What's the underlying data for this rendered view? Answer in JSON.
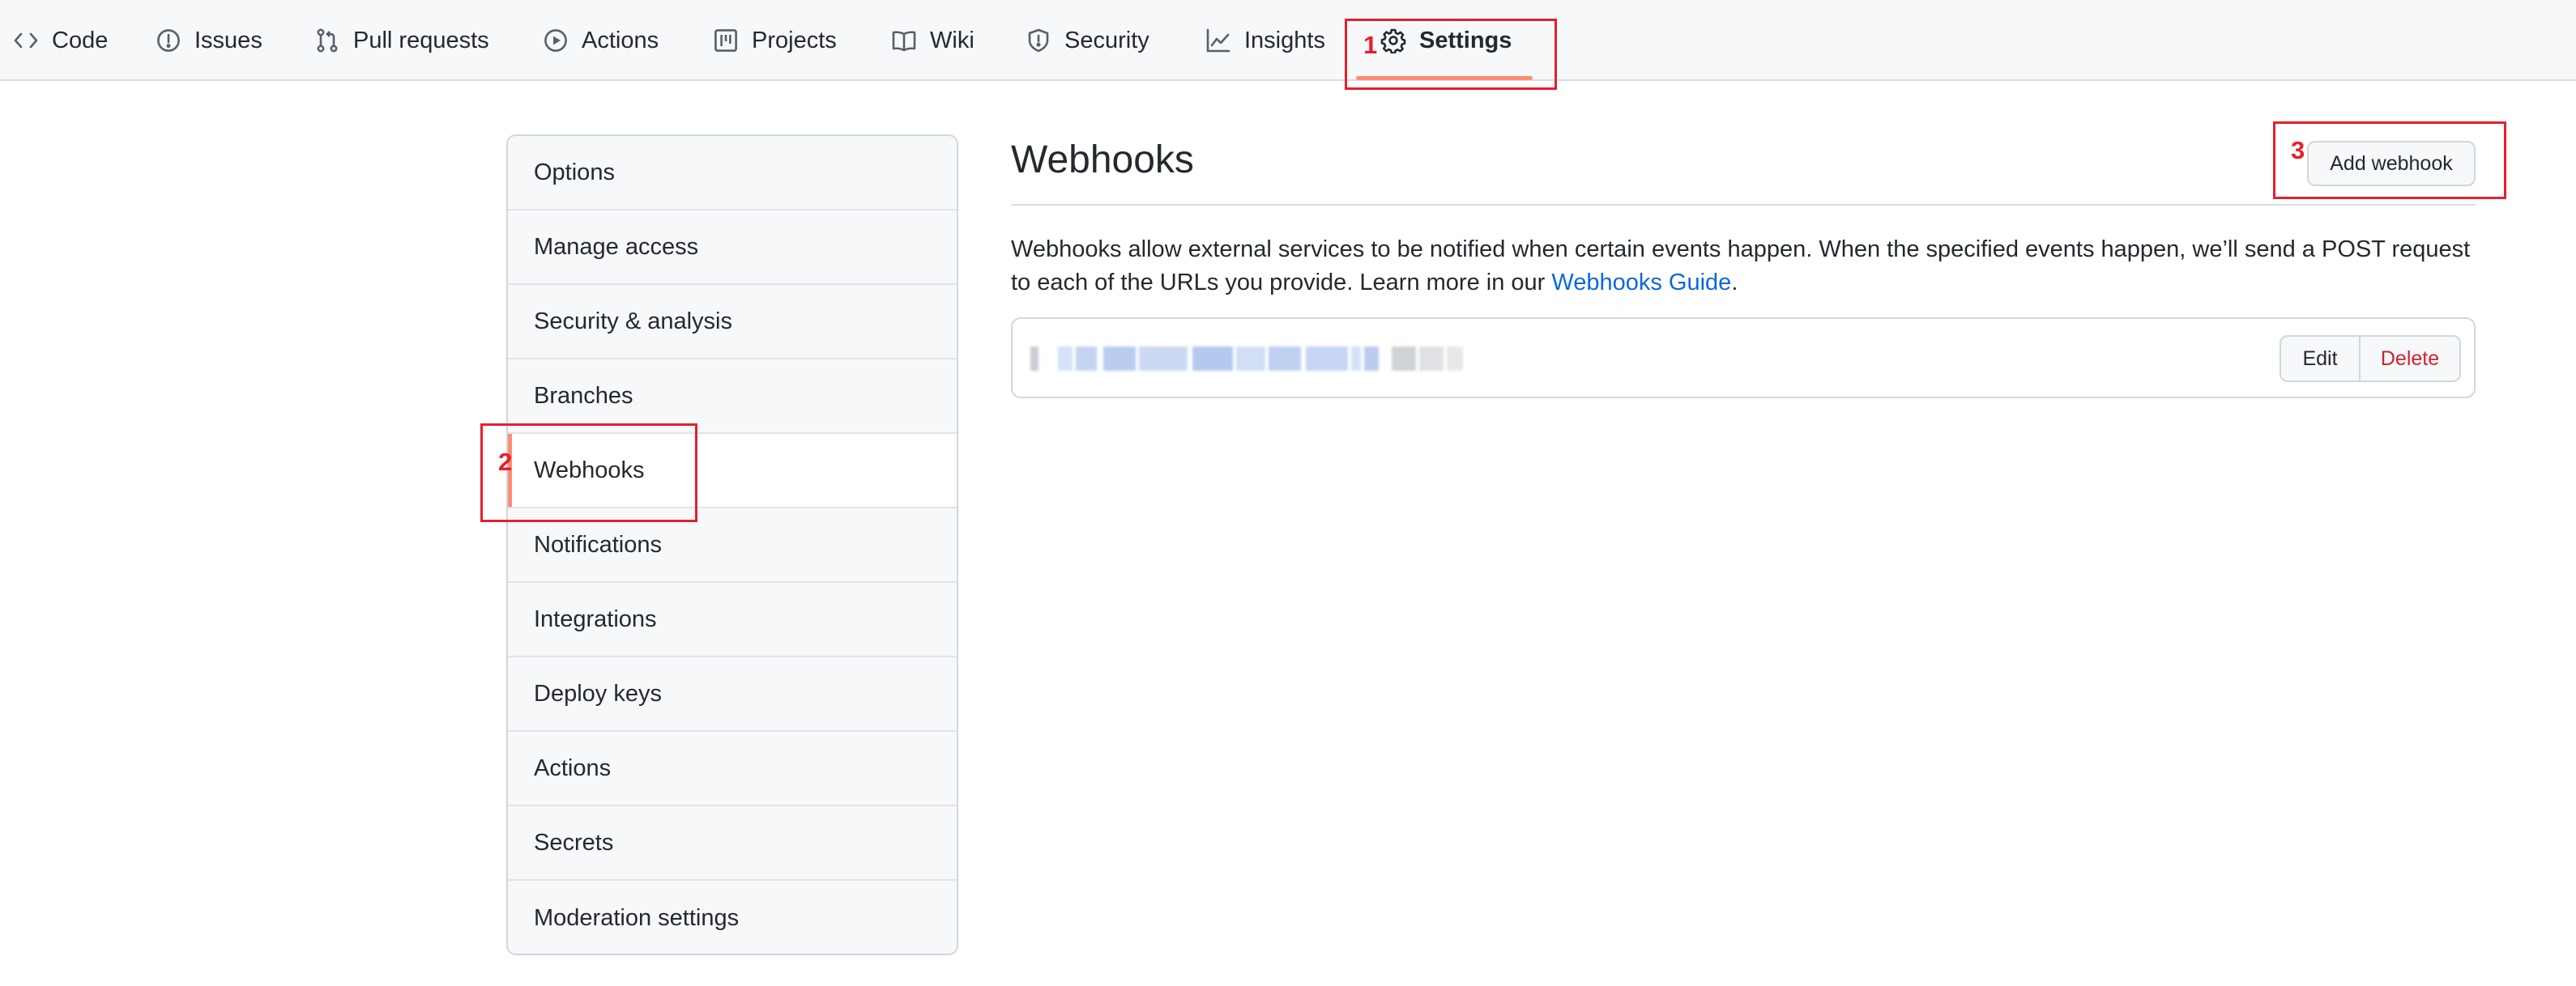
{
  "repo_nav": {
    "tabs": [
      {
        "label": "Code",
        "icon": "code-icon"
      },
      {
        "label": "Issues",
        "icon": "issue-icon"
      },
      {
        "label": "Pull requests",
        "icon": "pull-request-icon"
      },
      {
        "label": "Actions",
        "icon": "play-icon"
      },
      {
        "label": "Projects",
        "icon": "project-icon"
      },
      {
        "label": "Wiki",
        "icon": "book-icon"
      },
      {
        "label": "Security",
        "icon": "shield-icon"
      },
      {
        "label": "Insights",
        "icon": "graph-icon"
      },
      {
        "label": "Settings",
        "icon": "gear-icon",
        "selected": true
      }
    ]
  },
  "annotations": {
    "settings": "1",
    "webhooks": "2",
    "add_webhook": "3"
  },
  "sidebar": {
    "items": [
      {
        "label": "Options"
      },
      {
        "label": "Manage access"
      },
      {
        "label": "Security & analysis"
      },
      {
        "label": "Branches"
      },
      {
        "label": "Webhooks",
        "selected": true
      },
      {
        "label": "Notifications"
      },
      {
        "label": "Integrations"
      },
      {
        "label": "Deploy keys"
      },
      {
        "label": "Actions"
      },
      {
        "label": "Secrets"
      },
      {
        "label": "Moderation settings"
      }
    ]
  },
  "main": {
    "title": "Webhooks",
    "add_button": "Add webhook",
    "description": "Webhooks allow external services to be notified when certain events happen. When the specified events happen, we’ll send a POST request to each of the URLs you provide. Learn more in our ",
    "guide_link": "Webhooks Guide",
    "description_end": ".",
    "webhook": {
      "edit_label": "Edit",
      "delete_label": "Delete"
    }
  },
  "colors": {
    "accent_underline": "#fd8c73",
    "link": "#0969da",
    "danger": "#cf222e",
    "annotation": "#e5202e"
  }
}
